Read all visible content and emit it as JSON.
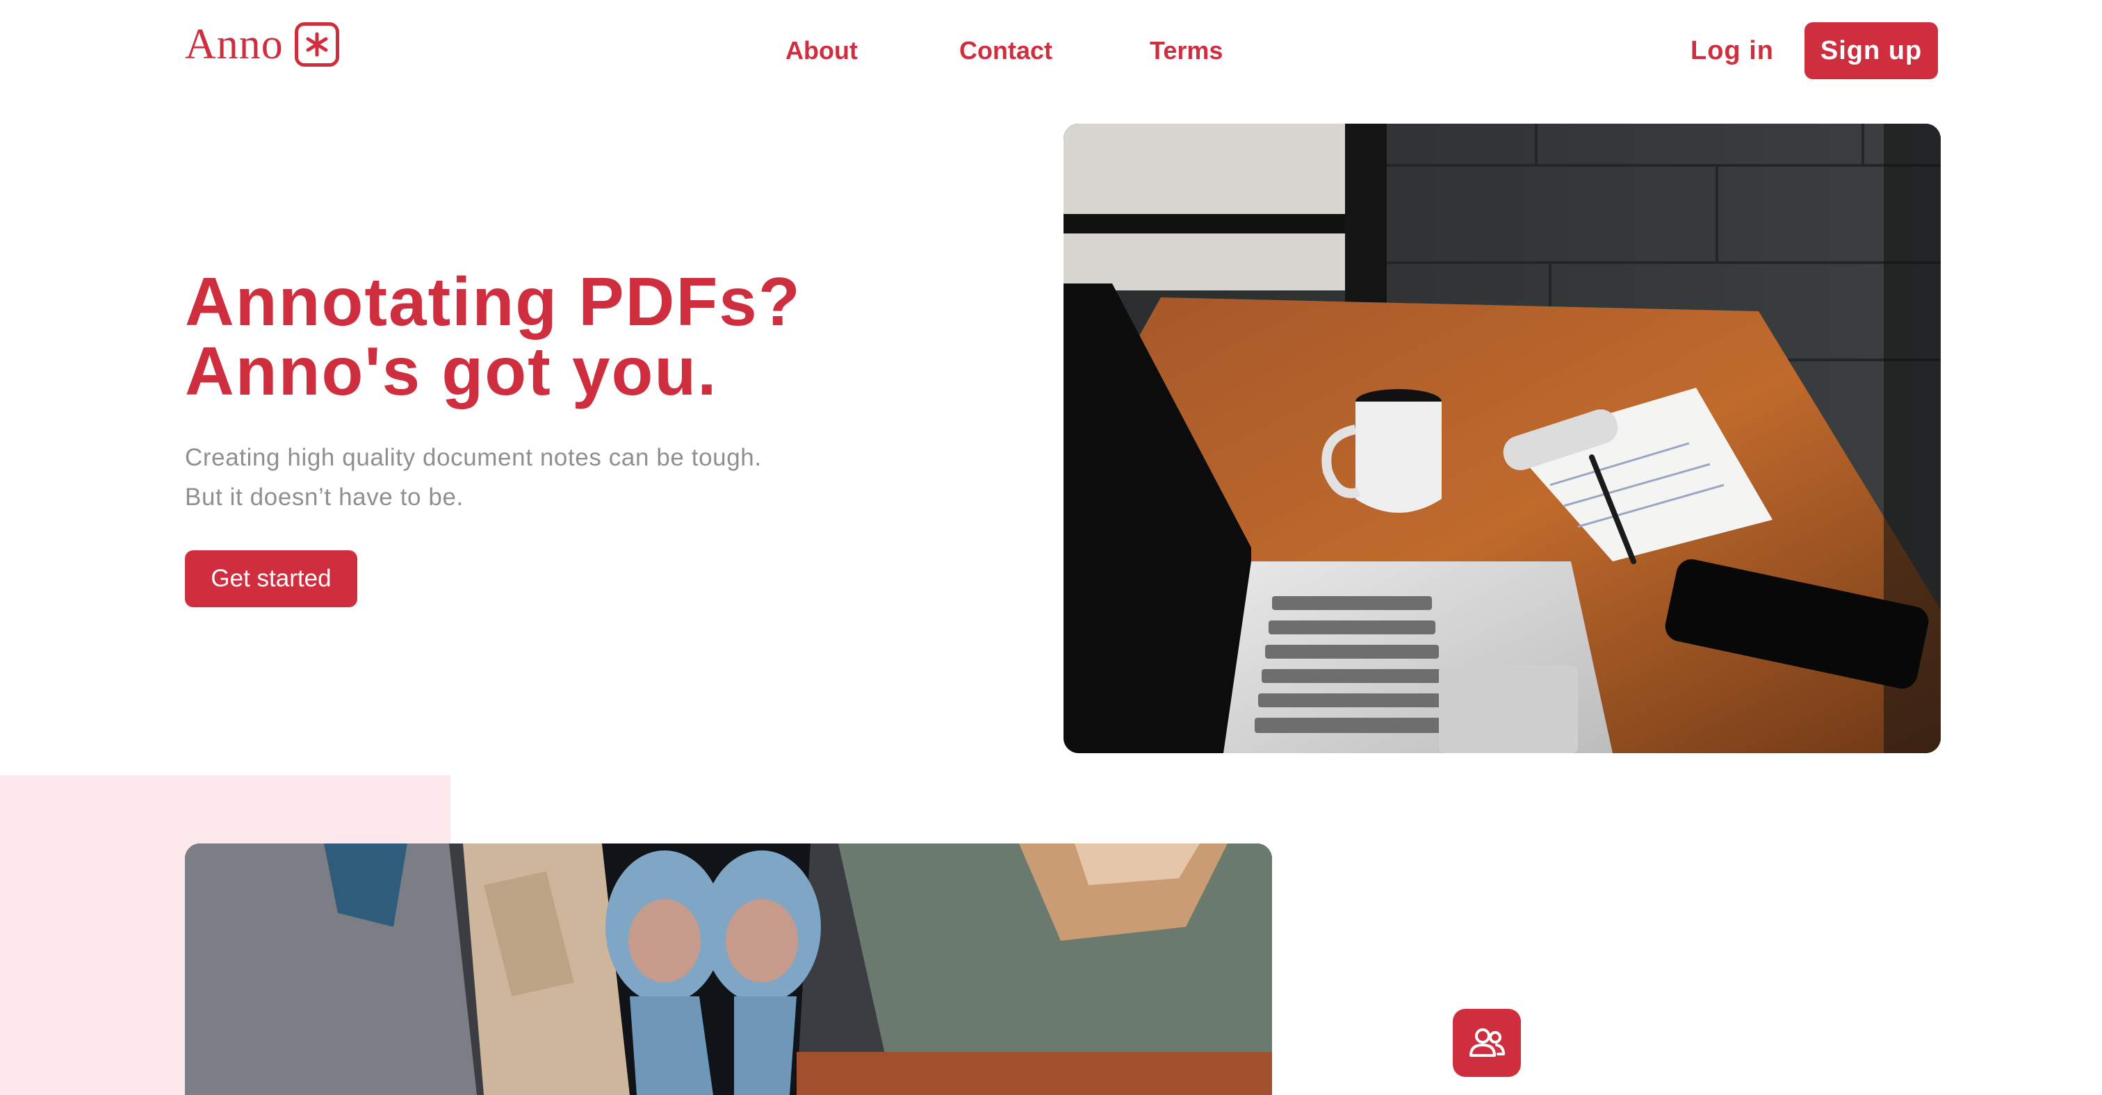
{
  "header": {
    "logo_text": "Anno",
    "logo_icon": "asterisk-icon",
    "nav": [
      {
        "label": "About"
      },
      {
        "label": "Contact"
      },
      {
        "label": "Terms"
      }
    ],
    "login_label": "Log in",
    "signup_label": "Sign up"
  },
  "hero": {
    "title_line1": "Annotating PDFs?",
    "title_line2": "Anno's got you.",
    "subtitle_line1": "Creating high quality document notes can be tough.",
    "subtitle_line2": "But it doesn’t have to be.",
    "cta_label": "Get started",
    "image": "laptop-coffee-notepad-desk-photo"
  },
  "feature": {
    "image": "group-of-people-sitting-photo",
    "icon": "users-icon"
  },
  "colors": {
    "brand": "#cf2e3e",
    "muted_text": "#8f8f8f",
    "accent_bg": "#fde9ec"
  }
}
